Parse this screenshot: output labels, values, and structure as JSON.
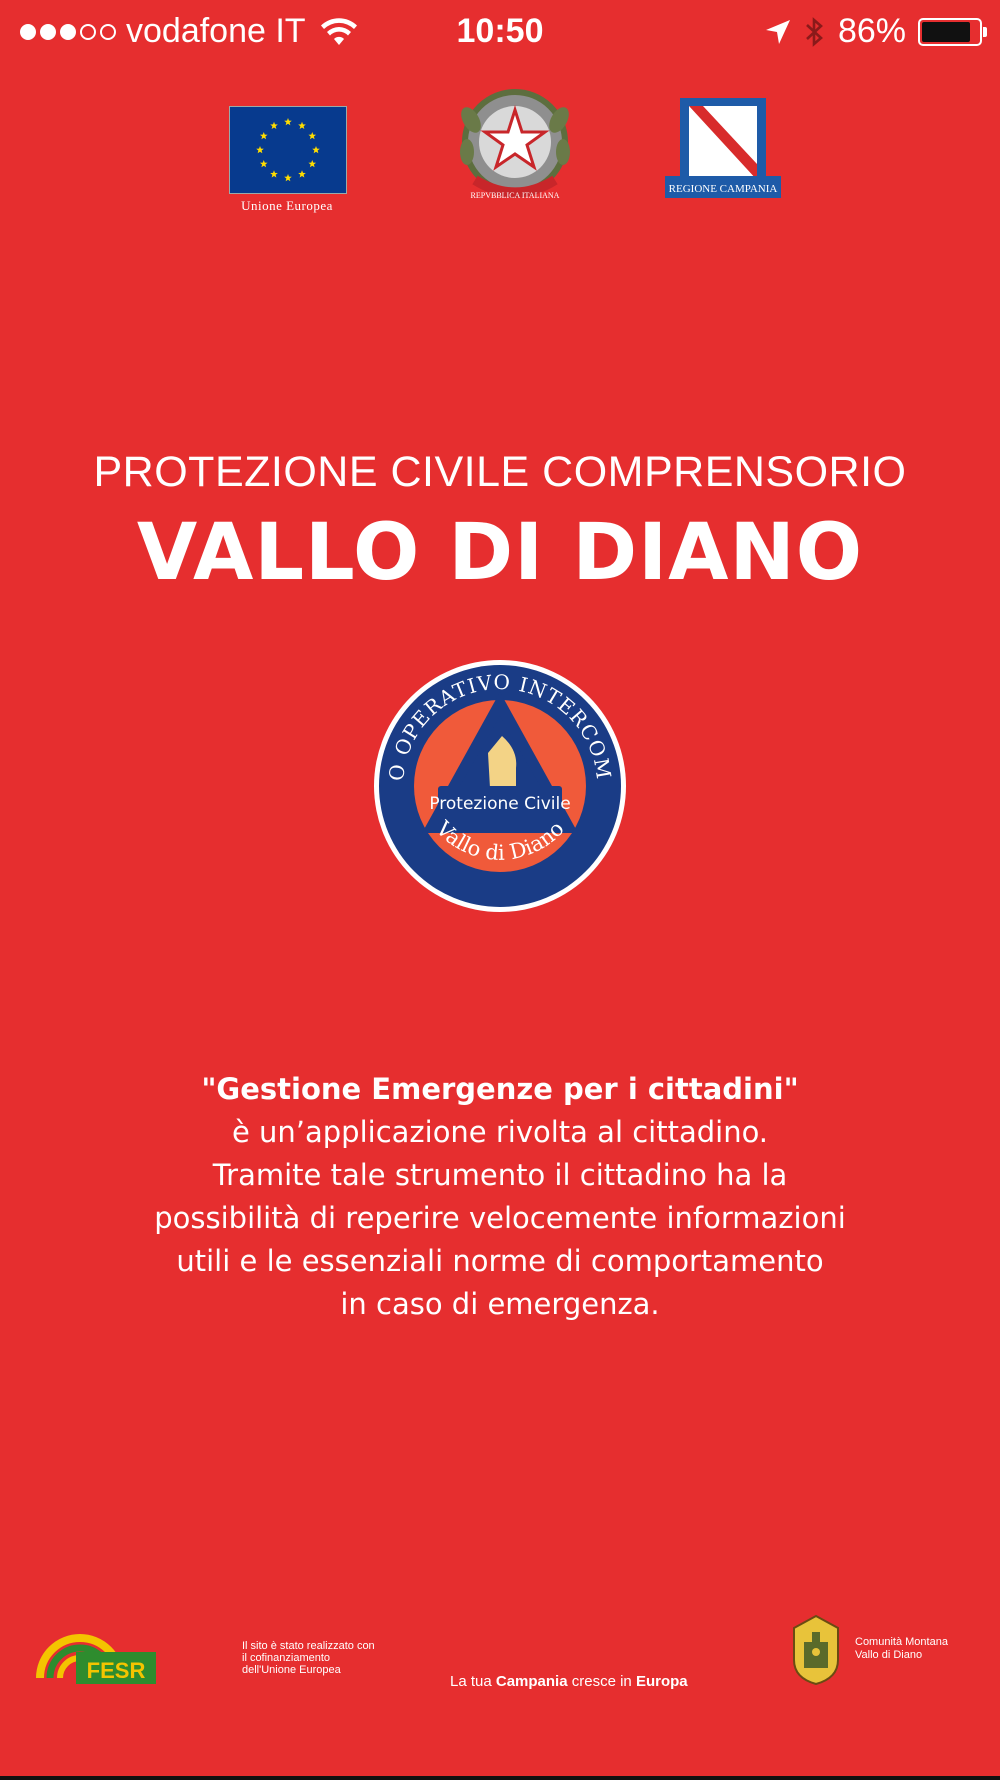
{
  "status_bar": {
    "carrier": "vodafone IT",
    "time": "10:50",
    "battery": "86%",
    "battery_level": 0.86,
    "signal_bars_filled": 3,
    "signal_bars_total": 5
  },
  "logos": {
    "eu_label": "Unione Europea",
    "italia_label": "REPVBBLICA ITALIANA",
    "campania_label": "REGIONE CAMPANIA"
  },
  "header": {
    "line1": "PROTEZIONE CIVILE COMPRENSORIO",
    "line2": "VALLO DI DIANO"
  },
  "badge": {
    "ring_text": "CENTRO OPERATIVO INTERCOMUNALE",
    "center_text": "Protezione Civile",
    "bottom_text": "Vallo di Diano"
  },
  "description": {
    "title": "\"Gestione Emergenze per i cittadini\"",
    "lines": [
      "è un’applicazione rivolta al cittadino.",
      "Tramite tale strumento il cittadino ha la",
      "possibilità di reperire velocemente informazioni",
      "utili e le essenziali norme di comportamento",
      "in caso di emergenza."
    ]
  },
  "footer": {
    "fesr_label": "FESR",
    "note_lines": [
      "Il sito è stato realizzato con",
      "il cofinanziamento",
      "dell'Unione Europea"
    ],
    "slogan_pre": "La tua ",
    "slogan_bold1": "Campania",
    "slogan_mid": " cresce in ",
    "slogan_bold2": "Europa",
    "montana_lines": [
      "Comunità Montana",
      "Vallo di Diano"
    ]
  },
  "colors": {
    "background": "#E62E2F",
    "badge_blue": "#1A3C86",
    "badge_orange": "#F05A3A",
    "eu_blue": "#073A8E",
    "eu_star": "#FFDD00",
    "campania_blue": "#1E5BA8"
  }
}
